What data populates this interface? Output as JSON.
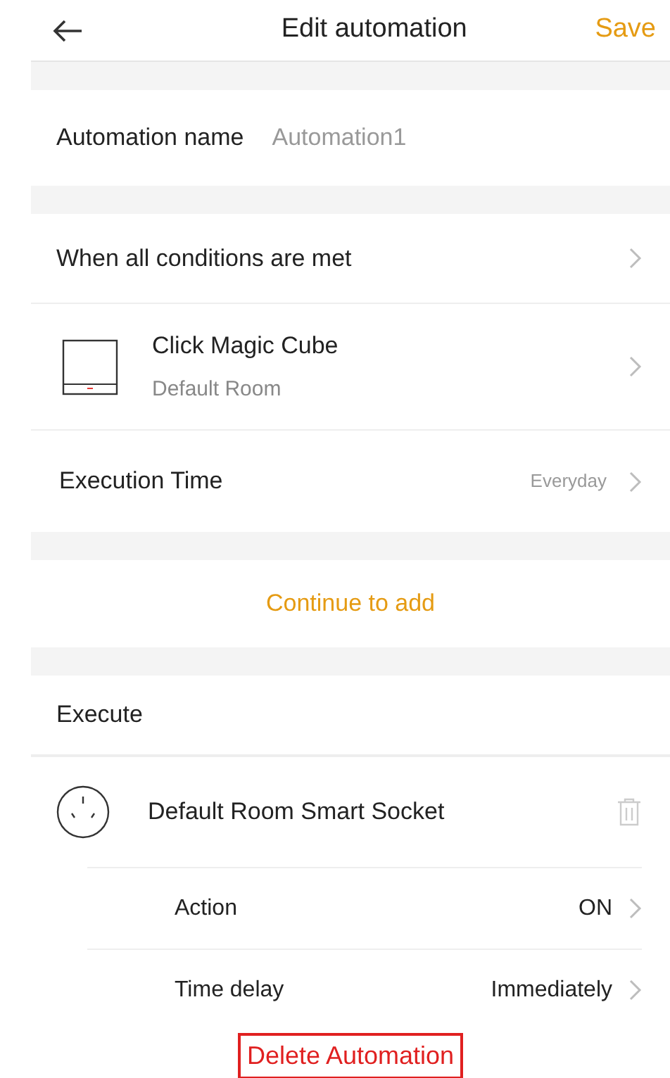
{
  "header": {
    "title": "Edit automation",
    "save": "Save"
  },
  "name_row": {
    "label": "Automation name",
    "value": "Automation1"
  },
  "conditions": {
    "heading": "When all conditions are met",
    "items": [
      {
        "kind": "device",
        "title": "Click Magic Cube",
        "subtitle": "Default Room"
      },
      {
        "kind": "setting",
        "title": "Execution Time",
        "value": "Everyday"
      }
    ]
  },
  "continue_link": "Continue to add",
  "execute": {
    "heading": "Execute",
    "device": "Default Room Smart Socket",
    "settings": [
      {
        "label": "Action",
        "value": "ON"
      },
      {
        "label": "Time delay",
        "value": "Immediately"
      }
    ]
  },
  "delete_button": "Delete Automation"
}
